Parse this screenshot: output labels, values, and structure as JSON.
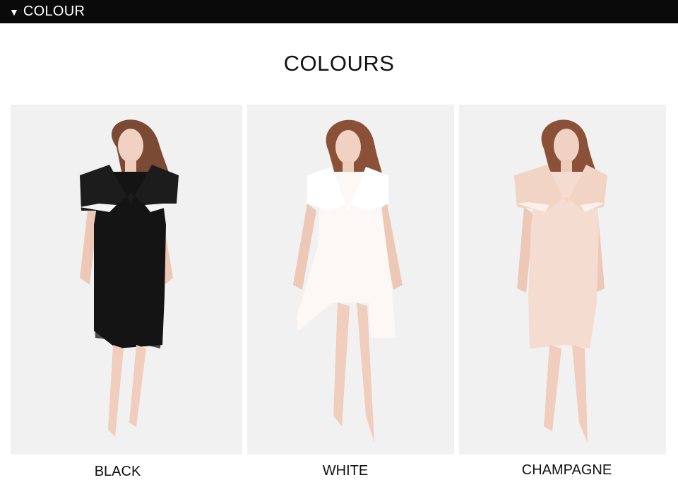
{
  "header": {
    "arrow_icon": "triangle-down-icon",
    "title": "COLOUR"
  },
  "section_title": "COLOURS",
  "variants": [
    {
      "label": "BLACK",
      "dress_color": "#141414",
      "lace_color": "#1c1c1c",
      "trim_color": "#f4f4f4"
    },
    {
      "label": "WHITE",
      "dress_color": "#fbf8f6",
      "lace_color": "#ffffff",
      "trim_color": "#ffffff"
    },
    {
      "label": "CHAMPAGNE",
      "dress_color": "#f4dcd1",
      "lace_color": "#f2d4c4",
      "trim_color": "#fbf1ea"
    }
  ]
}
